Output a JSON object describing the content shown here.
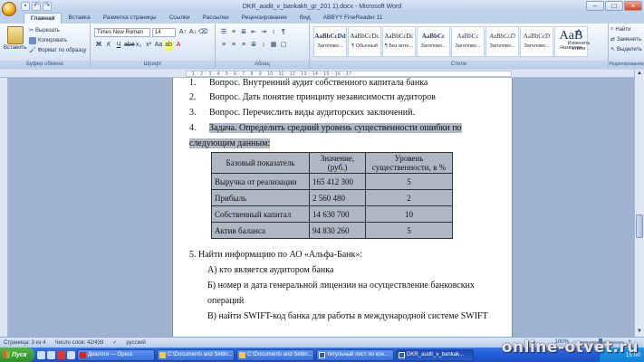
{
  "window": {
    "title": "DKR_audit_v_bankakh_gr_201 1).docx - Microsoft Word",
    "buttons": [
      "–",
      "□",
      "×"
    ]
  },
  "tabs": [
    "Главная",
    "Вставка",
    "Разметка страницы",
    "Ссылки",
    "Рассылки",
    "Рецензирование",
    "Вид",
    "ABBYY FineReader 11"
  ],
  "ribbon": {
    "clipboard": {
      "paste": "Вставить",
      "cut": "Вырезать",
      "copy": "Копировать",
      "format_painter": "Формат по образцу",
      "label": "Буфер обмена"
    },
    "font": {
      "name": "Times New Roman",
      "size": "14",
      "label": "Шрифт"
    },
    "paragraph": {
      "label": "Абзац"
    },
    "styles": {
      "label": "Стили",
      "items": [
        {
          "sample": "AaBbCcDd",
          "name": "Заголово..."
        },
        {
          "sample": "AaBbCcDc",
          "name": "¶ Обычный"
        },
        {
          "sample": "AaBbCcDc",
          "name": "¶ Без инте..."
        },
        {
          "sample": "AaBbCc",
          "name": "Заголово..."
        },
        {
          "sample": "AaBbCc",
          "name": "Заголово..."
        },
        {
          "sample": "AaBbCcD",
          "name": "Заголово..."
        },
        {
          "sample": "AaBbCcD",
          "name": "Заголово..."
        },
        {
          "sample": "AaB",
          "name": "Название"
        }
      ],
      "change_styles": "Изменить стили"
    },
    "editing": {
      "find": "Найти",
      "replace": "Заменить",
      "select": "Выделить",
      "label": "Редактирование"
    }
  },
  "document": {
    "items": [
      {
        "num": "1.",
        "text": "Вопрос. Внутренний аудит собственного капитала банка"
      },
      {
        "num": "2.",
        "text": "Вопрос. Дать понятие принципу независимости аудиторов"
      },
      {
        "num": "3.",
        "text": "Вопрос. Перечислить виды аудиторских заключений."
      },
      {
        "num": "4.",
        "text": "Задача. Определить средний уровень существенности ошибки по"
      }
    ],
    "item4_continuation": "следующим данным:",
    "table": {
      "headers": [
        "Базовый показатель",
        "Значение, (руб.)",
        "Уровень существенности, в %"
      ],
      "rows": [
        [
          "Выручка от реализации",
          "165 412 300",
          "5"
        ],
        [
          "Прибыль",
          "2 560 480",
          "2"
        ],
        [
          "Собственный капитал",
          "14 630 700",
          "10"
        ],
        [
          "Актив баланса",
          "94 830 260",
          "5"
        ]
      ]
    },
    "task5": "5. Найти информацию по АО «Альфа-Банк»:",
    "task5_items": [
      "А)  кто является аудитором банка",
      "Б) номер и дата генеральной лицензии на осуществление банковских",
      "операций",
      "В) найти SWIFT-код банка для работы в международной системе SWIFT"
    ]
  },
  "status": {
    "page": "Страница: 3 из 4",
    "words": "Число слов: 42/439",
    "language": "русский",
    "zoom": "100%"
  },
  "taskbar": {
    "start": "Пуск",
    "buttons": [
      {
        "label": "Диалоги — Opera",
        "color": "#d8261c"
      },
      {
        "label": "C:\\Documents and Settin...",
        "color": "#f2c94c"
      },
      {
        "label": "C:\\Documents and Settin...",
        "color": "#f2c94c"
      },
      {
        "label": "титульный лист по кон...",
        "color": "#2b5fb8"
      },
      {
        "label": "DKR_audit_v_bankak...",
        "color": "#2b5fb8",
        "active": true
      }
    ],
    "clock": "15:00"
  },
  "watermark": "online-otvet.ru"
}
